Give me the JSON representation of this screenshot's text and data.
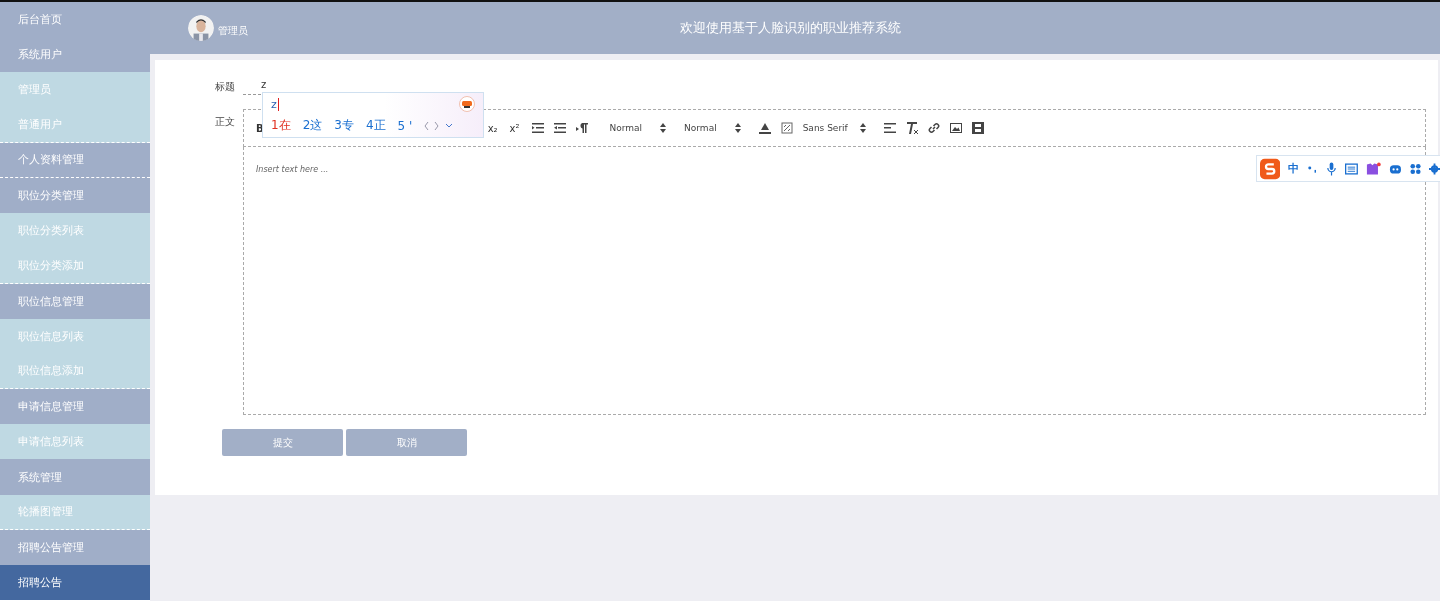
{
  "sidebar": {
    "items": [
      {
        "label": "后台首页",
        "kind": "group",
        "selected": false,
        "divider": false
      },
      {
        "label": "系统用户",
        "kind": "group",
        "selected": false,
        "divider": false
      },
      {
        "label": "管理员",
        "kind": "sub",
        "selected": false,
        "divider": false
      },
      {
        "label": "普通用户",
        "kind": "sub",
        "selected": false,
        "divider": true
      },
      {
        "label": "个人资料管理",
        "kind": "group",
        "selected": false,
        "divider": true
      },
      {
        "label": "职位分类管理",
        "kind": "group",
        "selected": false,
        "divider": false
      },
      {
        "label": "职位分类列表",
        "kind": "sub",
        "selected": false,
        "divider": false
      },
      {
        "label": "职位分类添加",
        "kind": "sub",
        "selected": false,
        "divider": true
      },
      {
        "label": "职位信息管理",
        "kind": "group",
        "selected": false,
        "divider": false
      },
      {
        "label": "职位信息列表",
        "kind": "sub",
        "selected": false,
        "divider": false
      },
      {
        "label": "职位信息添加",
        "kind": "sub",
        "selected": false,
        "divider": true
      },
      {
        "label": "申请信息管理",
        "kind": "group",
        "selected": false,
        "divider": false
      },
      {
        "label": "申请信息列表",
        "kind": "sub",
        "selected": false,
        "divider": false
      },
      {
        "label": "系统管理",
        "kind": "group",
        "selected": false,
        "divider": false
      },
      {
        "label": "轮播图管理",
        "kind": "sub",
        "selected": false,
        "divider": true
      },
      {
        "label": "招聘公告管理",
        "kind": "group",
        "selected": false,
        "divider": false
      },
      {
        "label": "招聘公告",
        "kind": "sub",
        "selected": true,
        "divider": false
      }
    ]
  },
  "header": {
    "user": "管理员",
    "title": "欢迎使用基于人脸识别的职业推荐系统"
  },
  "form": {
    "title_label": "标题",
    "title_value": "z",
    "body_label": "正文",
    "body_placeholder": "Insert text here ...",
    "toolbar": {
      "bold": "B",
      "header_select": "Normal",
      "size_select": "Normal",
      "font_select": "Sans Serif",
      "subscript": "x₂",
      "superscript": "x²"
    },
    "buttons": [
      "提交",
      "取消"
    ]
  },
  "ime": {
    "input": "z",
    "candidates": [
      "1在",
      "2这",
      "3专",
      "4正",
      "5 '"
    ],
    "mode": "中"
  }
}
